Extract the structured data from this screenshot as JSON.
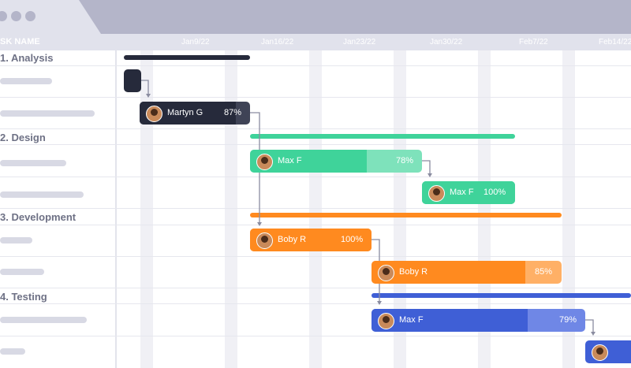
{
  "window": {
    "traffic_lights": [
      "window-dot",
      "window-dot",
      "window-dot"
    ]
  },
  "grid": {
    "column_header": "SK NAME",
    "dates": [
      "Jan9/22",
      "Jan16/22",
      "Jan23/22",
      "Jan30/22",
      "Feb7/22",
      "Feb14/22"
    ]
  },
  "sections": [
    {
      "label": "1. Analysis"
    },
    {
      "label": "2. Design"
    },
    {
      "label": "3. Development"
    },
    {
      "label": "4. Testing"
    }
  ],
  "tasks": [
    {
      "assignee": "Martyn G",
      "progress_label": "87%",
      "progress": 0.87,
      "color": "#262a3b",
      "progress_color": "#262a3b",
      "remainder_color": "#3f4356"
    },
    {
      "assignee": "Max F",
      "progress_label": "78%",
      "progress": 0.68,
      "color": "#3fd39a",
      "progress_color": "#3fd39a",
      "remainder_color": "#7ee2bb"
    },
    {
      "assignee": "Max F",
      "progress_label": "100%",
      "progress": 1.0,
      "color": "#3fd39a",
      "progress_color": "#3fd39a",
      "remainder_color": "#3fd39a"
    },
    {
      "assignee": "Boby R",
      "progress_label": "100%",
      "progress": 1.0,
      "color": "#ff8a1f",
      "progress_color": "#ff8a1f",
      "remainder_color": "#ff8a1f"
    },
    {
      "assignee": "Boby R",
      "progress_label": "85%",
      "progress": 0.81,
      "color": "#ff8a1f",
      "progress_color": "#ff8a1f",
      "remainder_color": "#ffb066"
    },
    {
      "assignee": "Max F",
      "progress_label": "79%",
      "progress": 0.73,
      "color": "#3f5fd6",
      "progress_color": "#3f5fd6",
      "remainder_color": "#6f87e6"
    }
  ],
  "summary_colors": {
    "analysis": "#262a3b",
    "design": "#3fd39a",
    "development": "#ff8a1f",
    "testing": "#3f5fd6"
  }
}
